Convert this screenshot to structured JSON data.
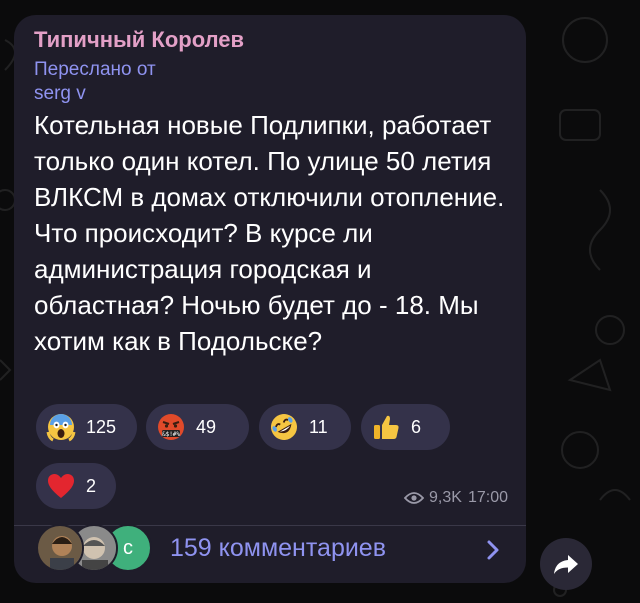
{
  "post": {
    "sender": "Типичный Королев",
    "forwarded_label": "Переслано от",
    "forwarded_from": "serg v",
    "text": "Котельная новые Подлипки, работает только один котел. По улице 50 летия ВЛКСМ в домах отключили отопление. Что происходит? В курсе ли администрация городская и областная? Ночью будет до - 18. Мы хотим как в Подольске?",
    "views": "9,3K",
    "time": "17:00"
  },
  "reactions": [
    {
      "emoji": "scream-face-icon",
      "count": "125"
    },
    {
      "emoji": "cursing-face-icon",
      "count": "49"
    },
    {
      "emoji": "rofl-face-icon",
      "count": "11"
    },
    {
      "emoji": "thumbs-up-icon",
      "count": "6"
    },
    {
      "emoji": "red-heart-icon",
      "count": "2"
    }
  ],
  "comments": {
    "avatar_letter": "c",
    "label": "159 комментариев"
  },
  "colors": {
    "background": "#0b0b0c",
    "bubble": "#1f1d2a",
    "sender_name": "#e3a0c7",
    "link_accent": "#8f93f0",
    "reaction_pill": "#34324a",
    "meta_text": "#9a99a8",
    "avatar_c": "#3fb07c"
  }
}
